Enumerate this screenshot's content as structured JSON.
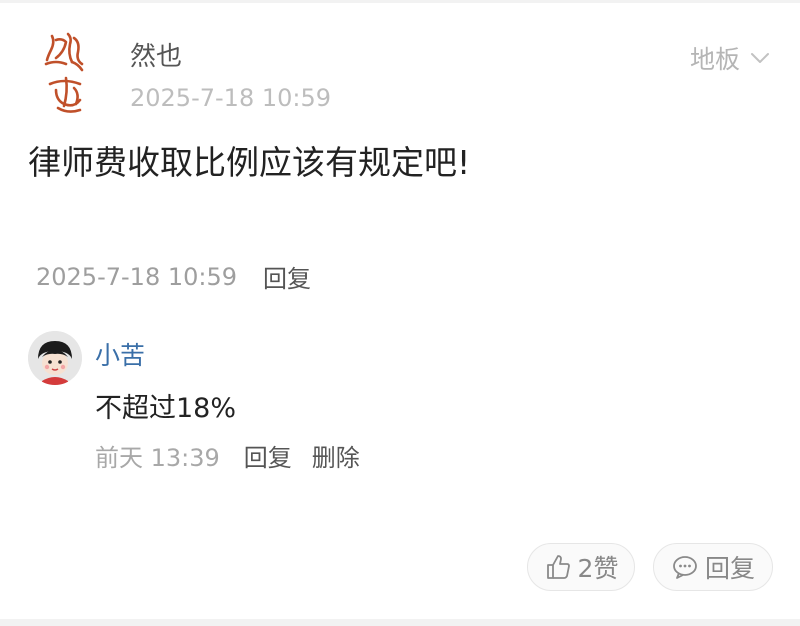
{
  "post": {
    "author": "然也",
    "time": "2025-7-18 10:59",
    "floor": "地板",
    "content": "律师费收取比例应该有规定吧!",
    "meta_time": "2025-7-18 10:59",
    "meta_reply": "回复",
    "avatar_seal_text": "然也"
  },
  "reply": {
    "author": "小苦",
    "content": "不超过18%",
    "time": "前天 13:39",
    "reply_label": "回复",
    "delete_label": "删除"
  },
  "actions": {
    "like_count": "2赞",
    "reply_label": "回复"
  },
  "colors": {
    "name_link": "#3a6fa8",
    "seal_red": "#c0502a",
    "muted": "#bdbdbd"
  }
}
